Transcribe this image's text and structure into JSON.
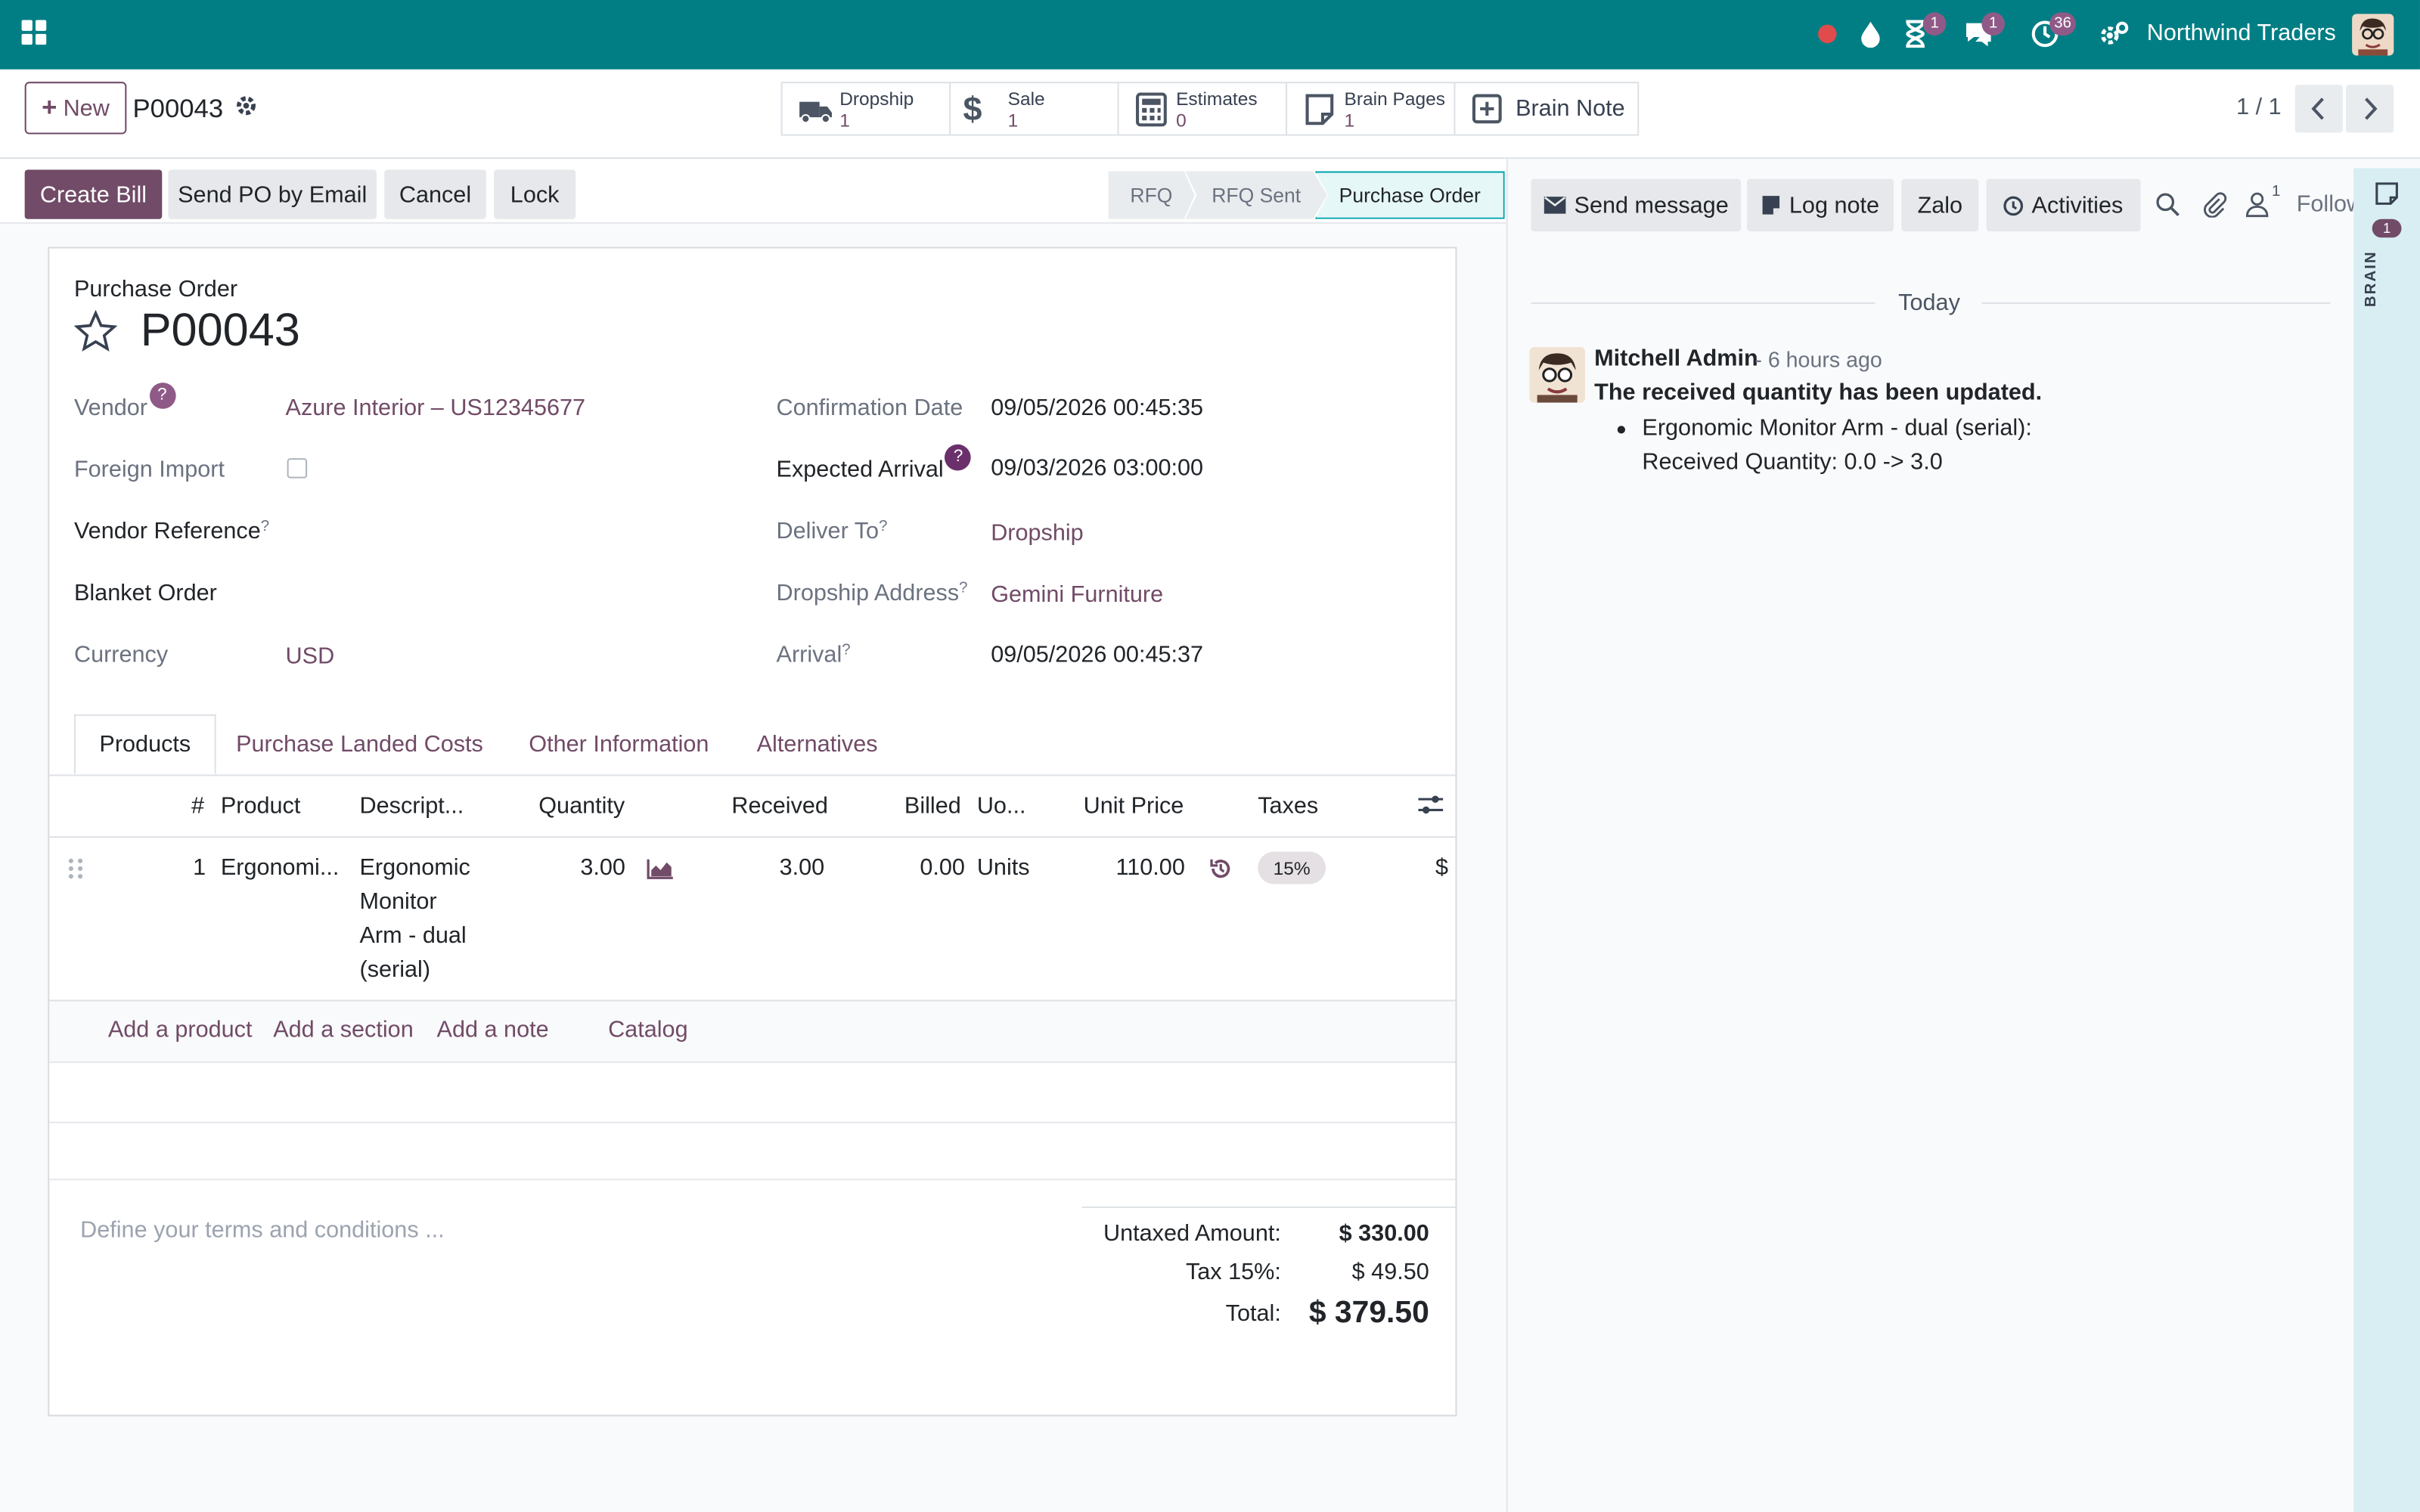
{
  "navbar": {
    "company": "Northwind Traders",
    "activity_badge": "1",
    "messages_badge": "1",
    "clock_badge": "36",
    "colors": {
      "bar": "#017e84",
      "badge": "#8f5a87",
      "record_dot": "#e04b4b"
    }
  },
  "control_panel": {
    "new_label": "New",
    "breadcrumb": "P00043",
    "pager": "1 / 1",
    "smart_buttons": [
      {
        "label": "Dropship",
        "value": "1",
        "icon": "truck-icon"
      },
      {
        "label": "Sale",
        "value": "1",
        "icon": "dollar-icon"
      },
      {
        "label": "Estimates",
        "value": "0",
        "icon": "calculator-icon"
      },
      {
        "label": "Brain Pages",
        "value": "1",
        "icon": "note-icon"
      },
      {
        "label": "Brain Note",
        "icon": "plus-square-icon"
      }
    ]
  },
  "actions": {
    "create_bill": "Create Bill",
    "send_po": "Send PO by Email",
    "cancel": "Cancel",
    "lock": "Lock"
  },
  "statusbar": {
    "stages": [
      "RFQ",
      "RFQ Sent",
      "Purchase Order"
    ],
    "current": "Purchase Order"
  },
  "form": {
    "header_label": "Purchase Order",
    "name": "P00043",
    "vendor_label": "Vendor",
    "vendor": "Azure Interior – US12345677",
    "foreign_import_label": "Foreign Import",
    "vendor_ref_label": "Vendor Reference",
    "blanket_label": "Blanket Order",
    "currency_label": "Currency",
    "currency": "USD",
    "confirmation_label": "Confirmation Date",
    "confirmation": "09/05/2026 00:45:35",
    "expected_label": "Expected Arrival",
    "expected": "09/03/2026 03:00:00",
    "deliver_label": "Deliver To",
    "deliver": "Dropship",
    "dropship_label": "Dropship Address",
    "dropship": "Gemini Furniture",
    "arrival_label": "Arrival",
    "arrival": "09/05/2026 00:45:37",
    "help_mark": "?"
  },
  "tabs": [
    "Products",
    "Purchase Landed Costs",
    "Other Information",
    "Alternatives"
  ],
  "table": {
    "headers": {
      "num": "#",
      "product": "Product",
      "description": "Descript...",
      "quantity": "Quantity",
      "received": "Received",
      "billed": "Billed",
      "uom": "Uo...",
      "unit_price": "Unit Price",
      "taxes": "Taxes"
    },
    "row": {
      "num": "1",
      "product": "Ergonomi...",
      "description": [
        "Ergonomic",
        "Monitor",
        "Arm - dual",
        "(serial)"
      ],
      "quantity": "3.00",
      "received": "3.00",
      "billed": "0.00",
      "uom": "Units",
      "unit_price": "110.00",
      "tax": "15%",
      "subtotal_cut": "$"
    },
    "add_product": "Add a product",
    "add_section": "Add a section",
    "add_note": "Add a note",
    "catalog": "Catalog"
  },
  "totals": {
    "terms_placeholder": "Define your terms and conditions ...",
    "untaxed_label": "Untaxed Amount:",
    "untaxed": "$ 330.00",
    "tax_label": "Tax 15%:",
    "tax": "$ 49.50",
    "total_label": "Total:",
    "total": "$ 379.50"
  },
  "chatter": {
    "send_message": "Send message",
    "log_note": "Log note",
    "zalo": "Zalo",
    "activities": "Activities",
    "followers_count": "1",
    "follow": "Follow",
    "today": "Today",
    "author": "Mitchell Admin",
    "ago": "- 6 hours ago",
    "body": "The received quantity has been updated.",
    "line1": "Ergonomic Monitor Arm - dual (serial):",
    "line2": "Received Quantity: 0.0 -> 3.0"
  },
  "brain": {
    "badge": "1",
    "label": "BRAIN"
  }
}
